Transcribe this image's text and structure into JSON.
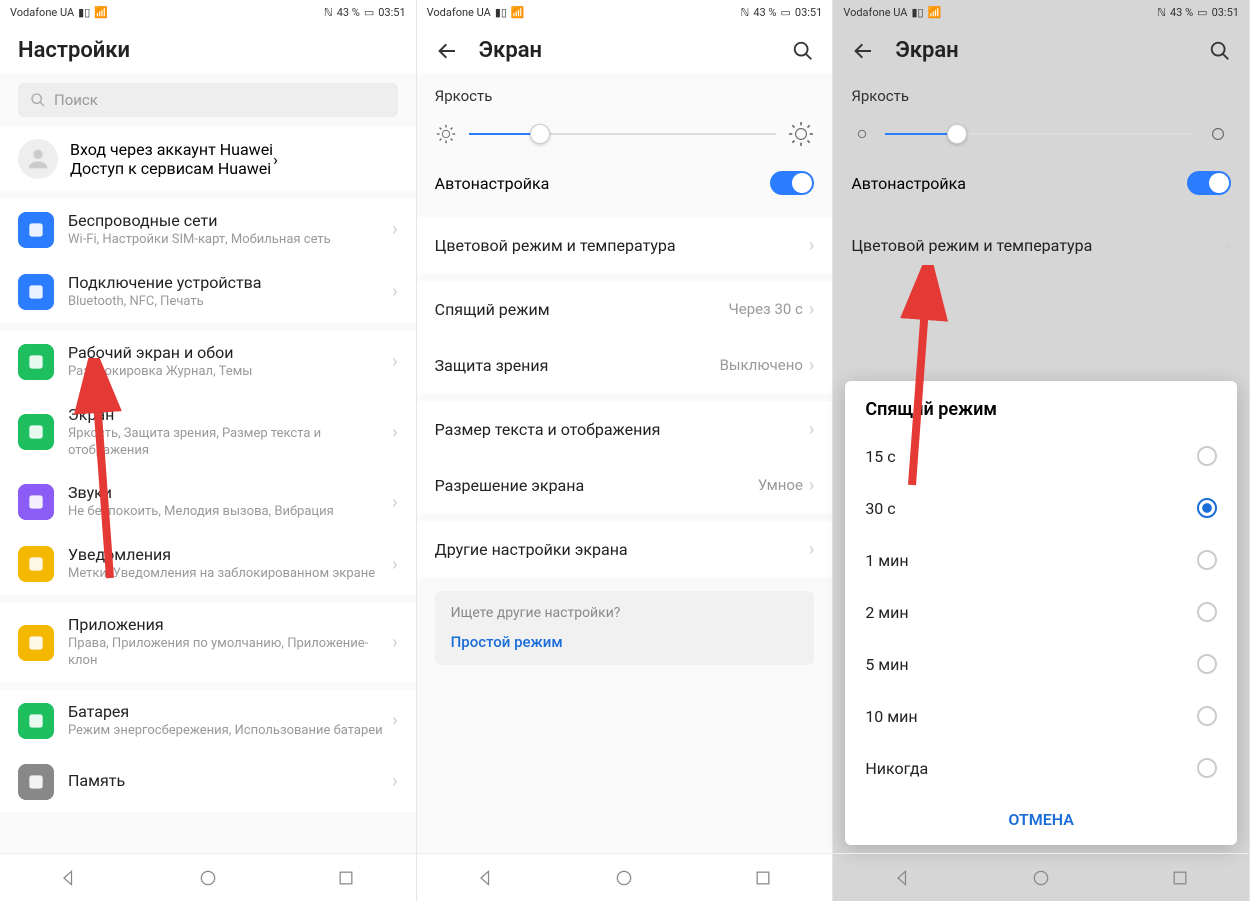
{
  "statusbar": {
    "carrier": "Vodafone UA",
    "nfc": "43 %",
    "time": "03:51"
  },
  "screen1": {
    "title": "Настройки",
    "search_placeholder": "Поиск",
    "account_title": "Вход через аккаунт Huawei",
    "account_sub": "Доступ к сервисам Huawei",
    "items": [
      {
        "name": "wireless",
        "title": "Беспроводные сети",
        "sub": "Wi-Fi, Настройки SIM-карт, Мобильная сеть",
        "color": "#2b7cff"
      },
      {
        "name": "device-conn",
        "title": "Подключение устройства",
        "sub": "Bluetooth, NFC, Печать",
        "color": "#2b7cff"
      },
      {
        "name": "home-wall",
        "title": "Рабочий экран и обои",
        "sub": "Разблокировка Журнал, Темы",
        "color": "#1dbf5f"
      },
      {
        "name": "display",
        "title": "Экран",
        "sub": "Яркость, Защита зрения, Размер текста и отображения",
        "color": "#1dbf5f"
      },
      {
        "name": "sound",
        "title": "Звуки",
        "sub": "Не беспокоить, Мелодия вызова, Вибрация",
        "color": "#8b5cf6"
      },
      {
        "name": "notif",
        "title": "Уведомления",
        "sub": "Метки, Уведомления на заблокированном экране",
        "color": "#f5b800"
      },
      {
        "name": "apps",
        "title": "Приложения",
        "sub": "Права, Приложения по умолчанию, Приложение-клон",
        "color": "#f5b800"
      },
      {
        "name": "battery",
        "title": "Батарея",
        "sub": "Режим энергосбережения, Использование батареи",
        "color": "#1dbf5f"
      },
      {
        "name": "storage",
        "title": "Память",
        "sub": "",
        "color": "#888"
      }
    ]
  },
  "screen2": {
    "title": "Экран",
    "brightness_label": "Яркость",
    "auto_label": "Автонастройка",
    "items": [
      {
        "title": "Цветовой режим и температура",
        "val": ""
      },
      {
        "title": "Спящий режим",
        "val": "Через 30 с"
      },
      {
        "title": "Защита зрения",
        "val": "Выключено"
      },
      {
        "title": "Размер текста и отображения",
        "val": ""
      },
      {
        "title": "Разрешение экрана",
        "val": "Умное"
      },
      {
        "title": "Другие настройки экрана",
        "val": ""
      }
    ],
    "hint_q": "Ищете другие настройки?",
    "hint_link": "Простой режим"
  },
  "screen3": {
    "title": "Экран",
    "brightness_label": "Яркость",
    "auto_label": "Автонастройка",
    "color_mode": "Цветовой режим и температура",
    "dialog_title": "Спящий режим",
    "options": [
      "15 с",
      "30 с",
      "1 мин",
      "2 мин",
      "5 мин",
      "10 мин",
      "Никогда"
    ],
    "selected": "30 с",
    "cancel": "ОТМЕНА"
  }
}
